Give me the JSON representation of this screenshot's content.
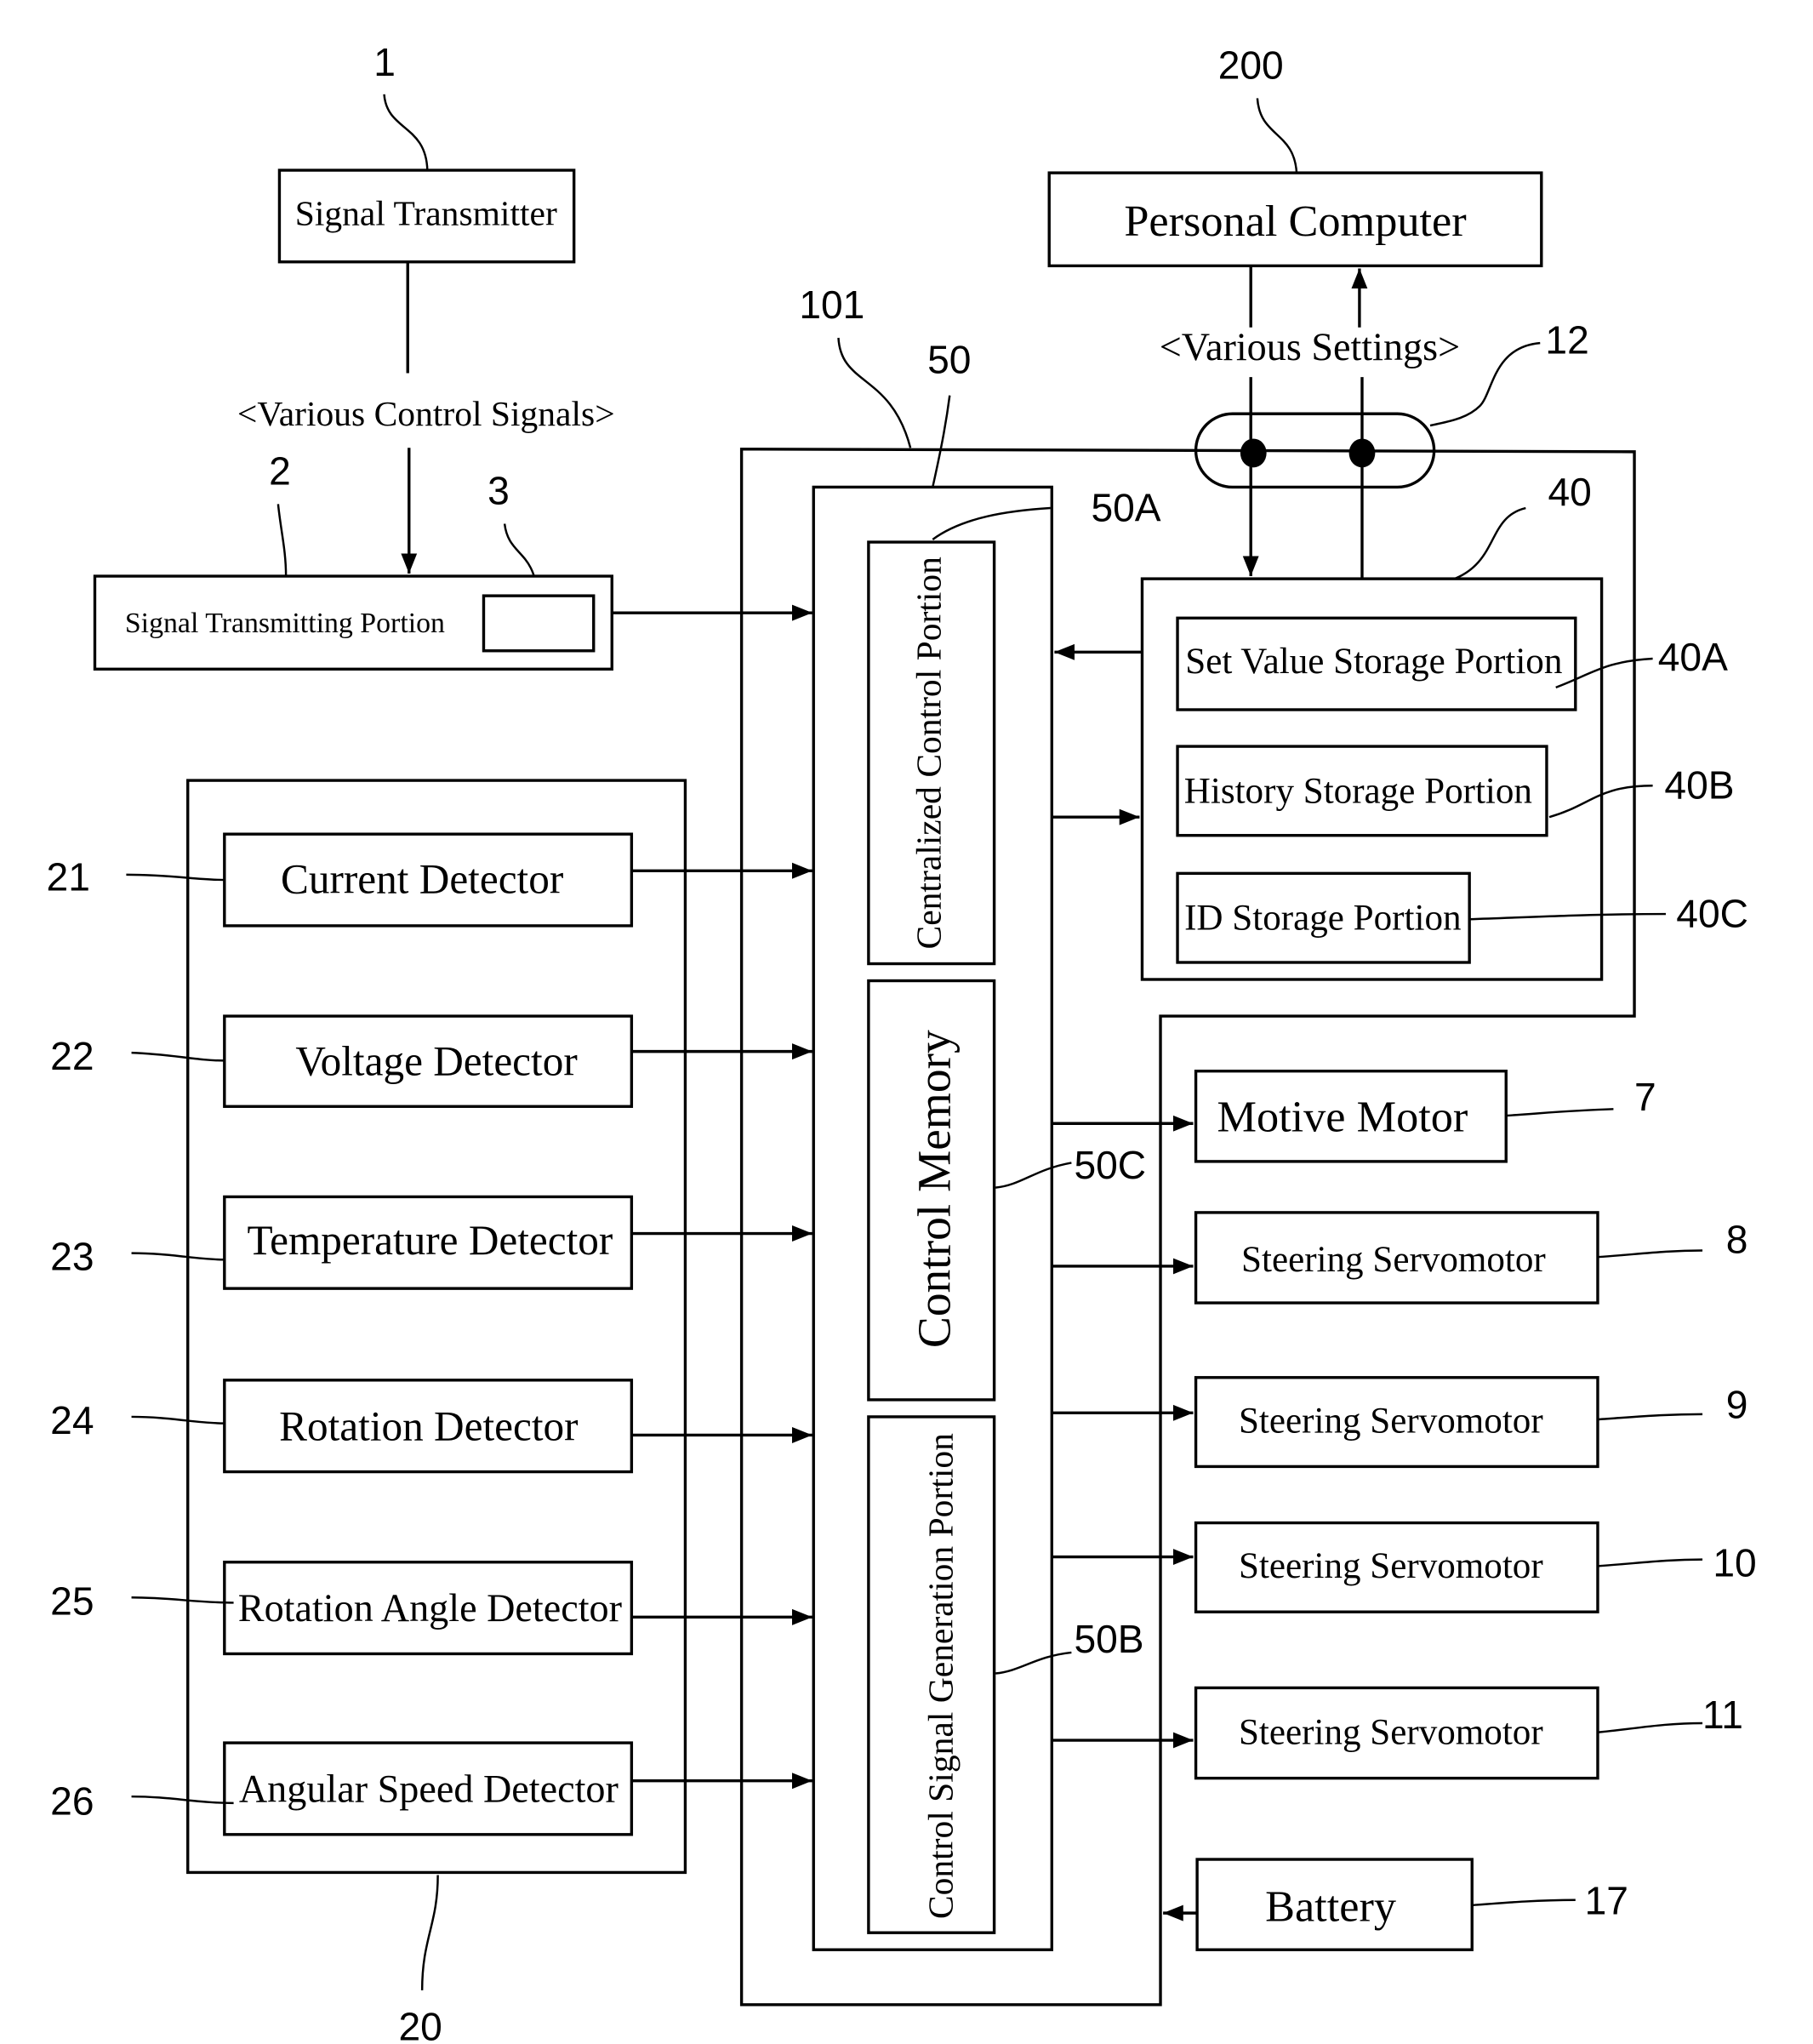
{
  "figure": {
    "signal_transmitter": {
      "ref": "1",
      "label": "Signal Transmitter"
    },
    "control_signals_label": "<Various Control Signals>",
    "signal_transmitting_portion": {
      "ref": "2",
      "label": "Signal Transmitting Portion",
      "sub_ref": "3"
    },
    "personal_computer": {
      "ref": "200",
      "label": "Personal Computer"
    },
    "settings_label": "<Various Settings>",
    "connector_ref": "12",
    "robot_ref": "101",
    "controller": {
      "ref": "50",
      "centralized": {
        "ref": "50A",
        "label": "Centralized Control Portion"
      },
      "memory": {
        "ref": "50C",
        "label": "Control Memory"
      },
      "signal_gen": {
        "ref": "50B",
        "label": "Control Signal Generation Portion"
      }
    },
    "storage": {
      "ref": "40",
      "items": [
        {
          "ref": "40A",
          "label": "Set Value Storage Portion"
        },
        {
          "ref": "40B",
          "label": "History Storage Portion"
        },
        {
          "ref": "40C",
          "label": "ID Storage Portion"
        }
      ]
    },
    "detectors": {
      "ref": "20",
      "items": [
        {
          "ref": "21",
          "label": "Current Detector"
        },
        {
          "ref": "22",
          "label": "Voltage Detector"
        },
        {
          "ref": "23",
          "label": "Temperature Detector"
        },
        {
          "ref": "24",
          "label": "Rotation Detector"
        },
        {
          "ref": "25",
          "label": "Rotation Angle Detector"
        },
        {
          "ref": "26",
          "label": "Angular Speed Detector"
        }
      ]
    },
    "outputs": [
      {
        "ref": "7",
        "label": "Motive Motor"
      },
      {
        "ref": "8",
        "label": "Steering Servomotor"
      },
      {
        "ref": "9",
        "label": "Steering Servomotor"
      },
      {
        "ref": "10",
        "label": "Steering Servomotor"
      },
      {
        "ref": "11",
        "label": "Steering Servomotor"
      }
    ],
    "battery": {
      "ref": "17",
      "label": "Battery"
    }
  }
}
